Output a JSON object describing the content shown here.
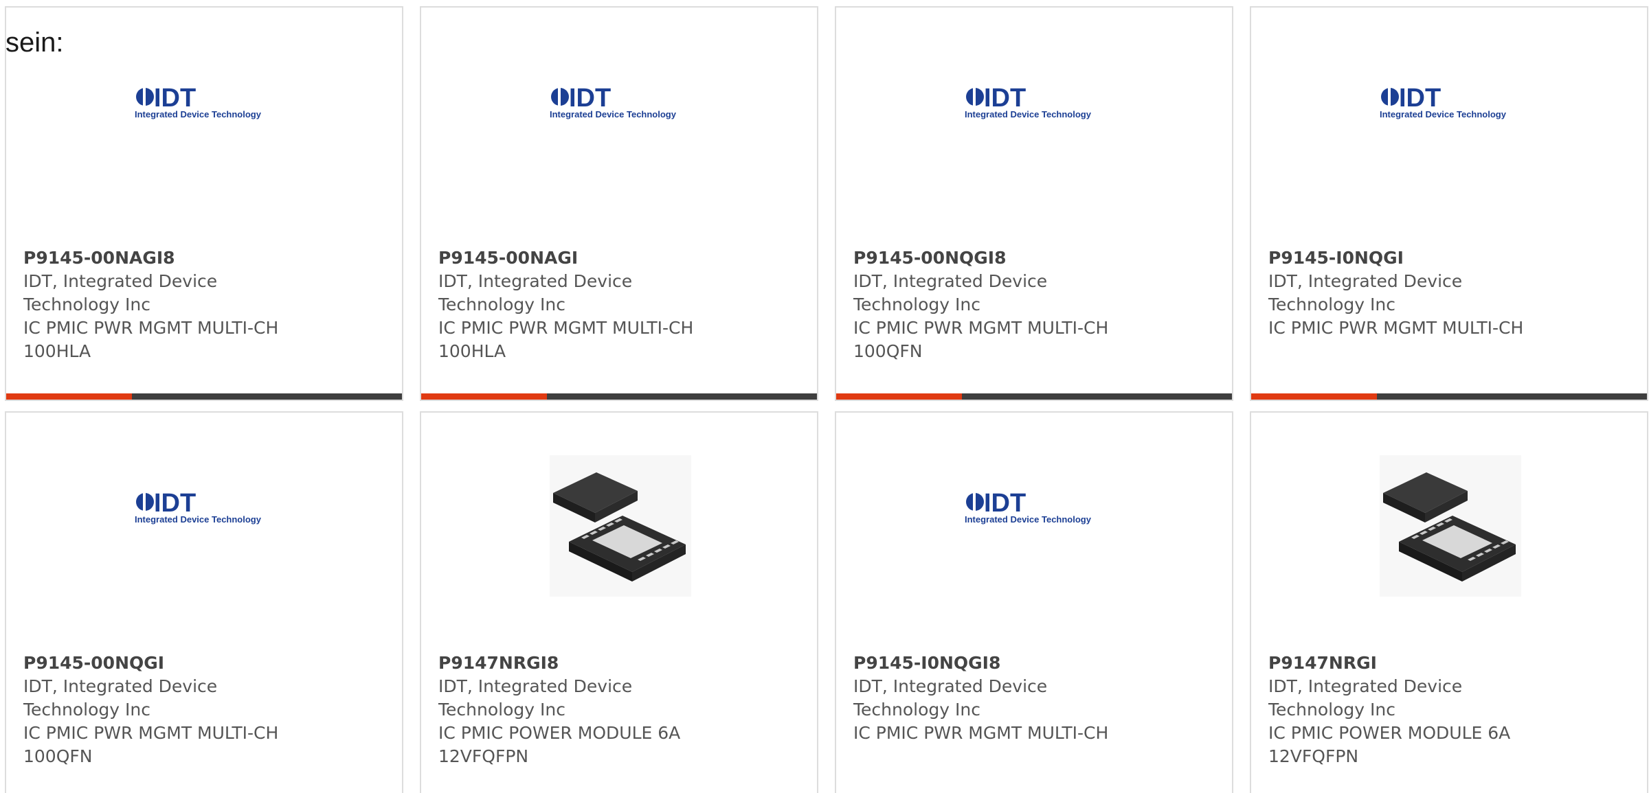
{
  "intro": {
    "text": "sein:"
  },
  "colors": {
    "accent": "#e03a12",
    "bar": "#3f3f3f",
    "border": "#dddddd",
    "idt_blue": "#1c3f94"
  },
  "products": [
    {
      "part_number": "P9145-00NAGI8",
      "manufacturer": "IDT, Integrated Device Technology Inc",
      "description": "IC PMIC PWR MGMT MULTI-CH 100HLA",
      "image": "idt-logo",
      "logo_text": "IDT",
      "logo_subtext": "Integrated Device Technology"
    },
    {
      "part_number": "P9145-00NAGI",
      "manufacturer": "IDT, Integrated Device Technology Inc",
      "description": "IC PMIC PWR MGMT MULTI-CH 100HLA",
      "image": "idt-logo",
      "logo_text": "IDT",
      "logo_subtext": "Integrated Device Technology"
    },
    {
      "part_number": "P9145-00NQGI8",
      "manufacturer": "IDT, Integrated Device Technology Inc",
      "description": "IC PMIC PWR MGMT MULTI-CH 100QFN",
      "image": "idt-logo",
      "logo_text": "IDT",
      "logo_subtext": "Integrated Device Technology"
    },
    {
      "part_number": "P9145-I0NQGI",
      "manufacturer": "IDT, Integrated Device Technology Inc",
      "description": "IC PMIC PWR MGMT MULTI-CH",
      "image": "idt-logo",
      "logo_text": "IDT",
      "logo_subtext": "Integrated Device Technology"
    },
    {
      "part_number": "P9145-00NQGI",
      "manufacturer": "IDT, Integrated Device Technology Inc",
      "description": "IC PMIC PWR MGMT MULTI-CH 100QFN",
      "image": "idt-logo",
      "logo_text": "IDT",
      "logo_subtext": "Integrated Device Technology"
    },
    {
      "part_number": "P9147NRGI8",
      "manufacturer": "IDT, Integrated Device Technology Inc",
      "description": "IC PMIC POWER MODULE 6A 12VFQFPN",
      "image": "qfn-chip-package"
    },
    {
      "part_number": "P9145-I0NQGI8",
      "manufacturer": "IDT, Integrated Device Technology Inc",
      "description": "IC PMIC PWR MGMT MULTI-CH",
      "image": "idt-logo",
      "logo_text": "IDT",
      "logo_subtext": "Integrated Device Technology"
    },
    {
      "part_number": "P9147NRGI",
      "manufacturer": "IDT, Integrated Device Technology Inc",
      "description": "IC PMIC POWER MODULE 6A 12VFQFPN",
      "image": "qfn-chip-package"
    }
  ]
}
